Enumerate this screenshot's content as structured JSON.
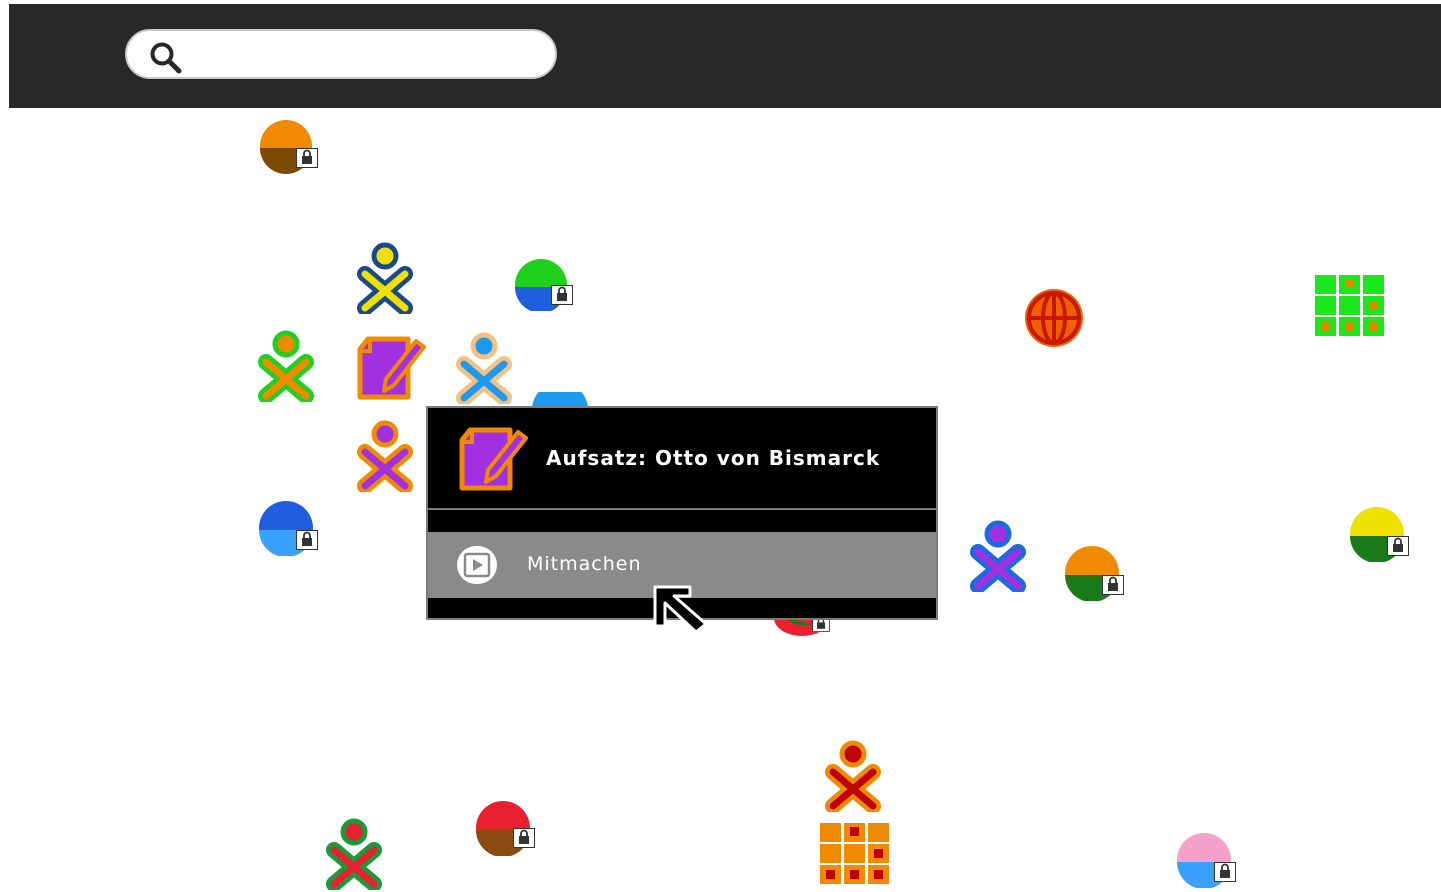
{
  "search": {
    "placeholder": "",
    "value": ""
  },
  "palette": {
    "title": "Aufsatz: Otto von Bismarck",
    "action_label": "Mitmachen"
  },
  "icons": [
    "buddy-icon",
    "shared-activity-icon",
    "write-activity-icon",
    "browse-activity-icon",
    "grid-activity-icon",
    "lock-icon",
    "play-icon",
    "cursor-icon"
  ]
}
